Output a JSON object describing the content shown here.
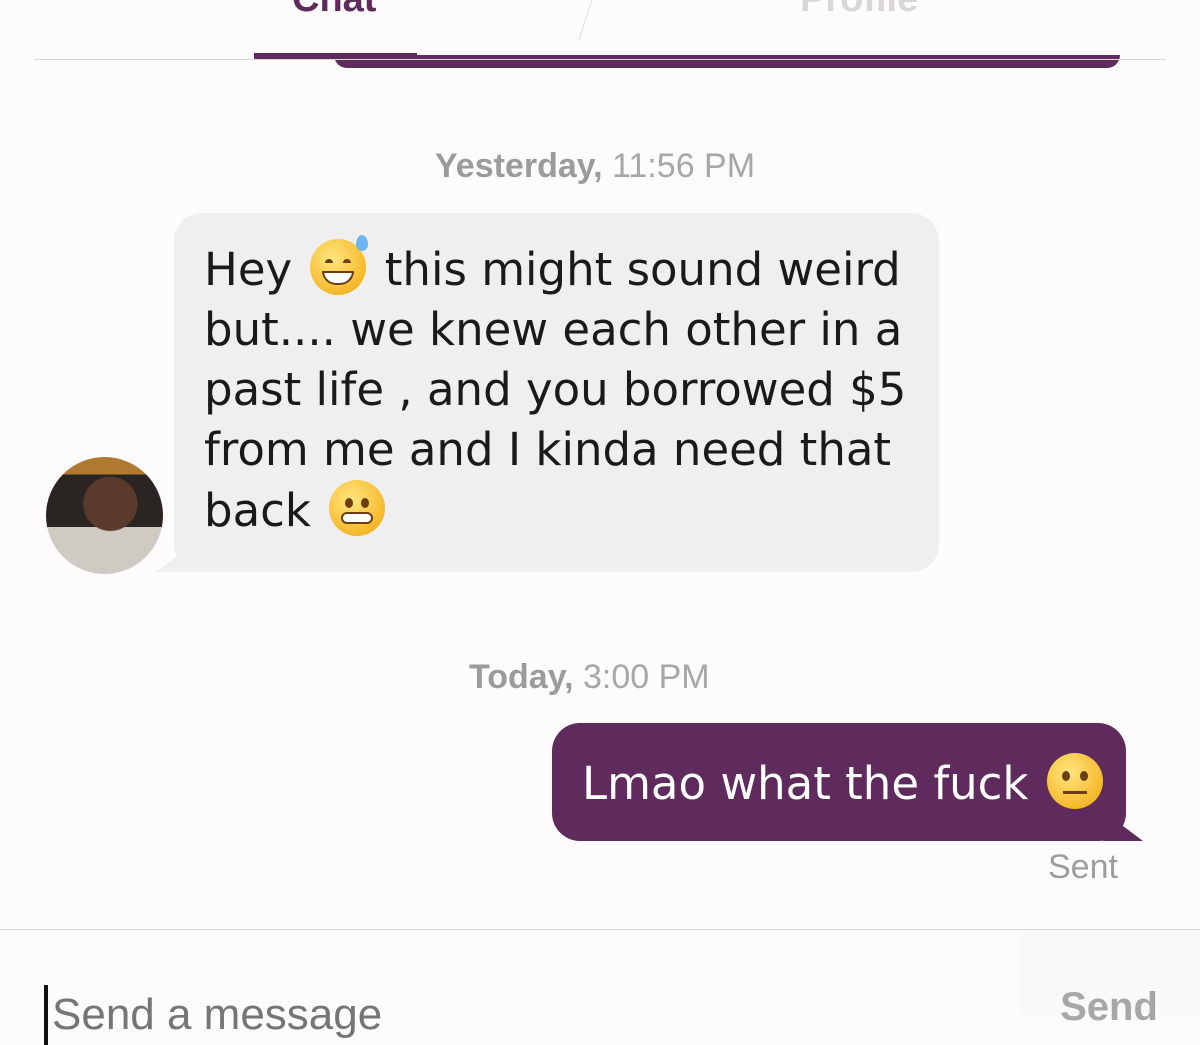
{
  "tabs": {
    "chat": "Chat",
    "profile": "Profile"
  },
  "messages": [
    {
      "timestamp_day": "Yesterday,",
      "timestamp_time": "11:56 PM",
      "direction": "incoming",
      "parts": [
        "Hey",
        "this might sound weird",
        "but.... we knew each other in a",
        "past life , and you borrowed $5",
        "from me and I kinda need that",
        "back"
      ],
      "emojis": [
        "sweat-smile-emoji",
        "grimacing-emoji"
      ]
    },
    {
      "timestamp_day": "Today,",
      "timestamp_time": "3:00 PM",
      "direction": "outgoing",
      "text": "Lmao what the fuck",
      "emoji": "raised-eyebrow-emoji",
      "status": "Sent"
    }
  ],
  "composer": {
    "placeholder": "Send a message",
    "send_label": "Send"
  },
  "colors": {
    "accent": "#5e2b5c",
    "incoming_bubble": "#efefef"
  }
}
